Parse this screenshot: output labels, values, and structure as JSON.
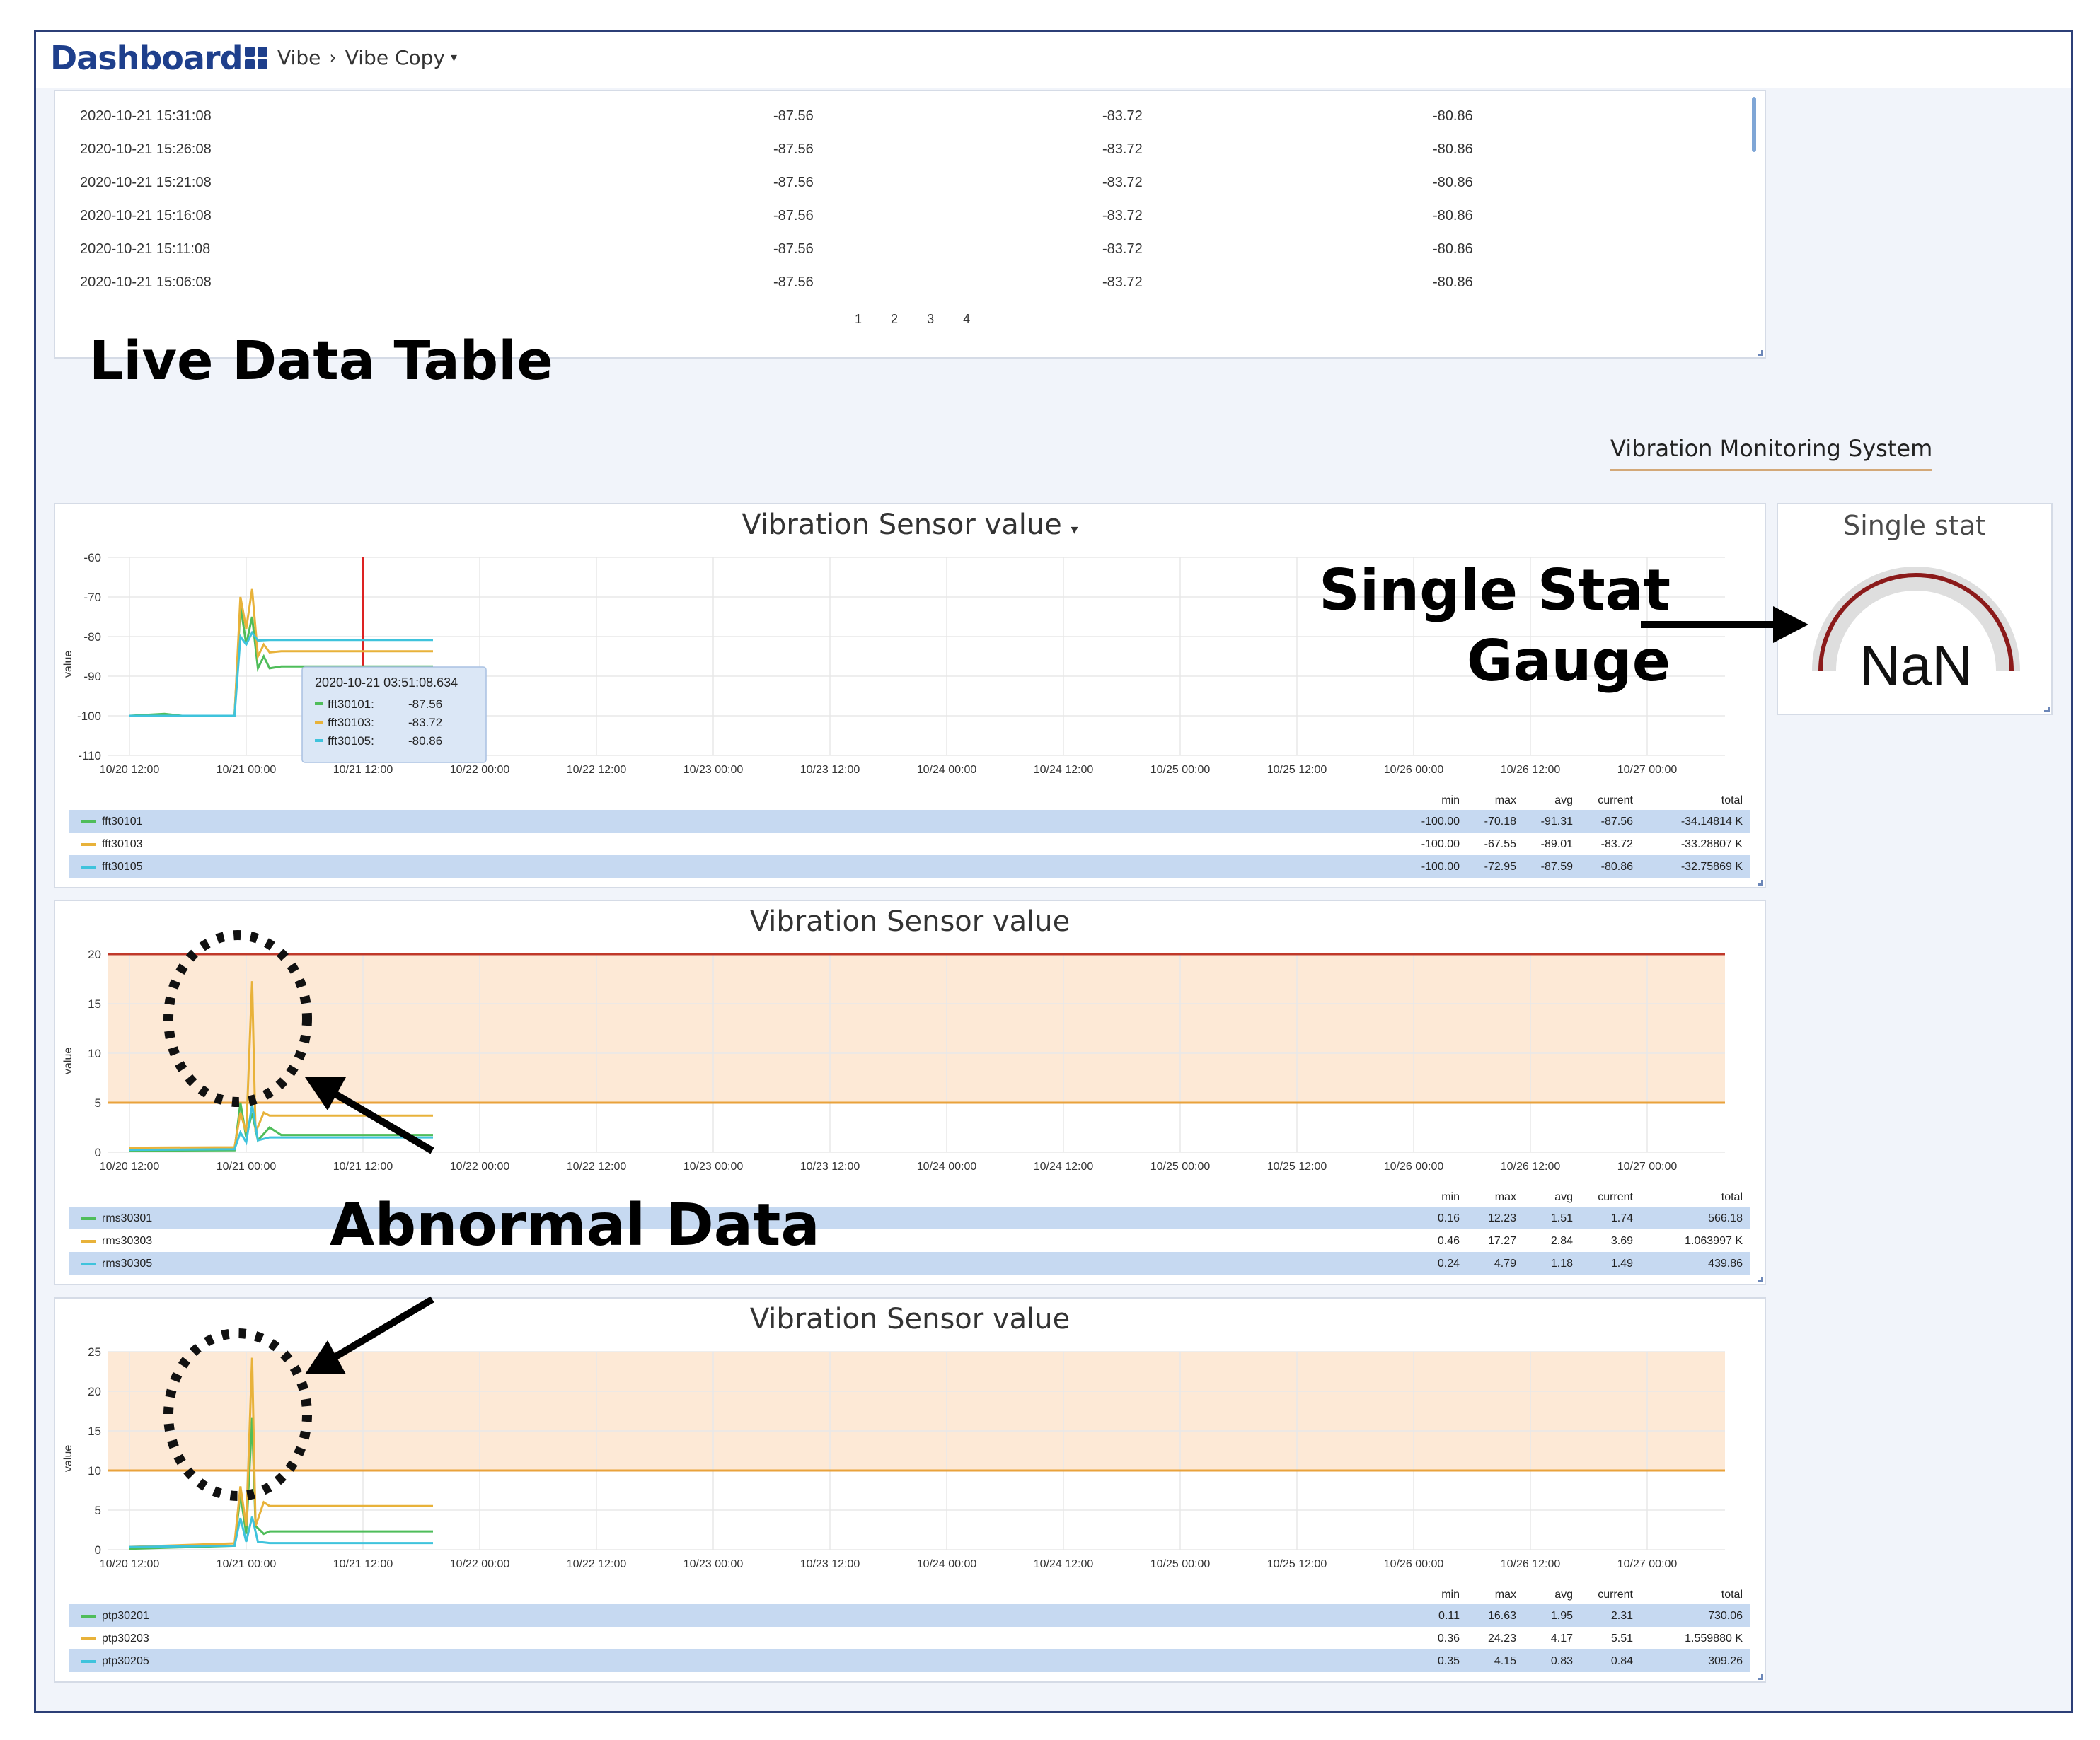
{
  "header": {
    "title": "Dashboard",
    "breadcrumb": [
      "Vibe",
      "Vibe Copy"
    ]
  },
  "table": {
    "rows": [
      [
        "2020-10-21 15:31:08",
        "-87.56",
        "-83.72",
        "-80.86"
      ],
      [
        "2020-10-21 15:26:08",
        "-87.56",
        "-83.72",
        "-80.86"
      ],
      [
        "2020-10-21 15:21:08",
        "-87.56",
        "-83.72",
        "-80.86"
      ],
      [
        "2020-10-21 15:16:08",
        "-87.56",
        "-83.72",
        "-80.86"
      ],
      [
        "2020-10-21 15:11:08",
        "-87.56",
        "-83.72",
        "-80.86"
      ],
      [
        "2020-10-21 15:06:08",
        "-87.56",
        "-83.72",
        "-80.86"
      ]
    ],
    "pages": [
      "1",
      "2",
      "3",
      "4"
    ]
  },
  "annotations": {
    "live_table": "Live Data Table",
    "gauge": "Single Stat Gauge",
    "abnormal": "Abnormal Data"
  },
  "text_panel": {
    "title": "Vibration Monitoring System"
  },
  "gauge": {
    "title": "Single stat",
    "value": "NaN",
    "arc_color": "#8b1a1a",
    "track_color": "#dedede"
  },
  "colors": {
    "green": "#4fbd5a",
    "yellow": "#e8b23a",
    "cyan": "#3fc3dc",
    "threshold_red": "#c0392b",
    "threshold_orange": "#e9a23b",
    "band_fill": "#fde9d6",
    "legend_shade": "#c6d9f1"
  },
  "chart_data": [
    {
      "type": "line",
      "title": "Vibration Sensor value",
      "ylabel": "value",
      "ylim": [
        -110,
        -60
      ],
      "yticks": [
        "-60",
        "-70",
        "-80",
        "-90",
        "-100",
        "-110"
      ],
      "x_ticks": [
        "10/20 12:00",
        "10/21 00:00",
        "10/21 12:00",
        "10/22 00:00",
        "10/22 12:00",
        "10/23 00:00",
        "10/23 12:00",
        "10/24 00:00",
        "10/24 12:00",
        "10/25 00:00",
        "10/25 12:00",
        "10/26 00:00",
        "10/26 12:00",
        "10/27 00:00"
      ],
      "crosshair_x": "10/21 12:00",
      "tooltip": {
        "time": "2020-10-21 03:51:08.634",
        "items": [
          {
            "name": "fft30101:",
            "value": "-87.56"
          },
          {
            "name": "fft30103:",
            "value": "-83.72"
          },
          {
            "name": "fft30105:",
            "value": "-80.86"
          }
        ]
      },
      "series": [
        {
          "name": "fft30101",
          "color": "green",
          "points": [
            [
              0.0,
              -100
            ],
            [
              0.3,
              -99.5
            ],
            [
              0.45,
              -100
            ],
            [
              0.9,
              -100
            ],
            [
              0.95,
              -72
            ],
            [
              1.0,
              -82
            ],
            [
              1.05,
              -75
            ],
            [
              1.1,
              -88
            ],
            [
              1.15,
              -85
            ],
            [
              1.2,
              -88
            ],
            [
              1.3,
              -87.56
            ],
            [
              2.6,
              -87.56
            ]
          ],
          "min": "-100.00",
          "max": "-70.18",
          "avg": "-91.31",
          "current": "-87.56",
          "total": "-34.14814 K"
        },
        {
          "name": "fft30103",
          "color": "yellow",
          "points": [
            [
              0.0,
              -100
            ],
            [
              0.9,
              -100
            ],
            [
              0.95,
              -70
            ],
            [
              1.0,
              -78
            ],
            [
              1.05,
              -68
            ],
            [
              1.1,
              -85
            ],
            [
              1.15,
              -82
            ],
            [
              1.2,
              -84
            ],
            [
              1.3,
              -83.72
            ],
            [
              2.6,
              -83.72
            ]
          ],
          "min": "-100.00",
          "max": "-67.55",
          "avg": "-89.01",
          "current": "-83.72",
          "total": "-33.28807 K"
        },
        {
          "name": "fft30105",
          "color": "cyan",
          "points": [
            [
              0.0,
              -100
            ],
            [
              0.9,
              -100
            ],
            [
              0.95,
              -80
            ],
            [
              1.0,
              -82
            ],
            [
              1.05,
              -79
            ],
            [
              1.1,
              -81
            ],
            [
              1.2,
              -80.86
            ],
            [
              2.6,
              -80.86
            ]
          ],
          "min": "-100.00",
          "max": "-72.95",
          "avg": "-87.59",
          "current": "-80.86",
          "total": "-32.75869 K"
        }
      ]
    },
    {
      "type": "line",
      "title": "Vibration Sensor value",
      "ylabel": "value",
      "ylim": [
        0,
        20
      ],
      "yticks": [
        "20",
        "15",
        "10",
        "5",
        "0"
      ],
      "thresholds": {
        "red": 20,
        "orange": 5,
        "band": [
          5,
          20
        ]
      },
      "x_ticks": [
        "10/20 12:00",
        "10/21 00:00",
        "10/21 12:00",
        "10/22 00:00",
        "10/22 12:00",
        "10/23 00:00",
        "10/23 12:00",
        "10/24 00:00",
        "10/24 12:00",
        "10/25 00:00",
        "10/25 12:00",
        "10/26 00:00",
        "10/26 12:00",
        "10/27 00:00"
      ],
      "series": [
        {
          "name": "rms30301",
          "color": "green",
          "points": [
            [
              0.0,
              0.16
            ],
            [
              0.9,
              0.2
            ],
            [
              0.95,
              5
            ],
            [
              1.0,
              1.5
            ],
            [
              1.05,
              4
            ],
            [
              1.1,
              1.2
            ],
            [
              1.2,
              2.5
            ],
            [
              1.3,
              1.74
            ],
            [
              2.6,
              1.74
            ]
          ],
          "min": "0.16",
          "max": "12.23",
          "avg": "1.51",
          "current": "1.74",
          "total": "566.18"
        },
        {
          "name": "rms30303",
          "color": "yellow",
          "points": [
            [
              0.0,
              0.46
            ],
            [
              0.9,
              0.5
            ],
            [
              0.95,
              4
            ],
            [
              1.0,
              2
            ],
            [
              1.05,
              17.27
            ],
            [
              1.08,
              2
            ],
            [
              1.15,
              4
            ],
            [
              1.2,
              3.69
            ],
            [
              2.6,
              3.69
            ]
          ],
          "min": "0.46",
          "max": "17.27",
          "avg": "2.84",
          "current": "3.69",
          "total": "1.063997 K"
        },
        {
          "name": "rms30305",
          "color": "cyan",
          "points": [
            [
              0.0,
              0.24
            ],
            [
              0.9,
              0.3
            ],
            [
              0.95,
              2
            ],
            [
              1.0,
              1
            ],
            [
              1.05,
              4.79
            ],
            [
              1.1,
              1.2
            ],
            [
              1.2,
              1.49
            ],
            [
              2.6,
              1.49
            ]
          ],
          "min": "0.24",
          "max": "4.79",
          "avg": "1.18",
          "current": "1.49",
          "total": "439.86"
        }
      ]
    },
    {
      "type": "line",
      "title": "Vibration Sensor value",
      "ylabel": "value",
      "ylim": [
        0,
        25
      ],
      "yticks": [
        "25",
        "20",
        "15",
        "10",
        "5",
        "0"
      ],
      "thresholds": {
        "orange": 10,
        "band": [
          10,
          25
        ]
      },
      "x_ticks": [
        "10/20 12:00",
        "10/21 00:00",
        "10/21 12:00",
        "10/22 00:00",
        "10/22 12:00",
        "10/23 00:00",
        "10/23 12:00",
        "10/24 00:00",
        "10/24 12:00",
        "10/25 00:00",
        "10/25 12:00",
        "10/26 00:00",
        "10/26 12:00",
        "10/27 00:00"
      ],
      "series": [
        {
          "name": "ptp30201",
          "color": "green",
          "points": [
            [
              0.0,
              0.11
            ],
            [
              0.9,
              0.5
            ],
            [
              0.95,
              7
            ],
            [
              1.0,
              2
            ],
            [
              1.05,
              16.63
            ],
            [
              1.08,
              3
            ],
            [
              1.15,
              2
            ],
            [
              1.2,
              2.31
            ],
            [
              2.6,
              2.31
            ]
          ],
          "min": "0.11",
          "max": "16.63",
          "avg": "1.95",
          "current": "2.31",
          "total": "730.06"
        },
        {
          "name": "ptp30203",
          "color": "yellow",
          "points": [
            [
              0.0,
              0.36
            ],
            [
              0.9,
              0.8
            ],
            [
              0.95,
              8
            ],
            [
              1.0,
              3
            ],
            [
              1.05,
              24.23
            ],
            [
              1.08,
              3
            ],
            [
              1.15,
              6
            ],
            [
              1.2,
              5.51
            ],
            [
              2.6,
              5.51
            ]
          ],
          "min": "0.36",
          "max": "24.23",
          "avg": "4.17",
          "current": "5.51",
          "total": "1.559880 K"
        },
        {
          "name": "ptp30205",
          "color": "cyan",
          "points": [
            [
              0.0,
              0.35
            ],
            [
              0.9,
              0.5
            ],
            [
              0.95,
              4
            ],
            [
              1.0,
              1
            ],
            [
              1.05,
              4.15
            ],
            [
              1.1,
              1
            ],
            [
              1.2,
              0.84
            ],
            [
              2.6,
              0.84
            ]
          ],
          "min": "0.35",
          "max": "4.15",
          "avg": "0.83",
          "current": "0.84",
          "total": "309.26"
        }
      ]
    }
  ],
  "legend_headers": {
    "min": "min",
    "max": "max",
    "avg": "avg",
    "current": "current",
    "total": "total"
  }
}
